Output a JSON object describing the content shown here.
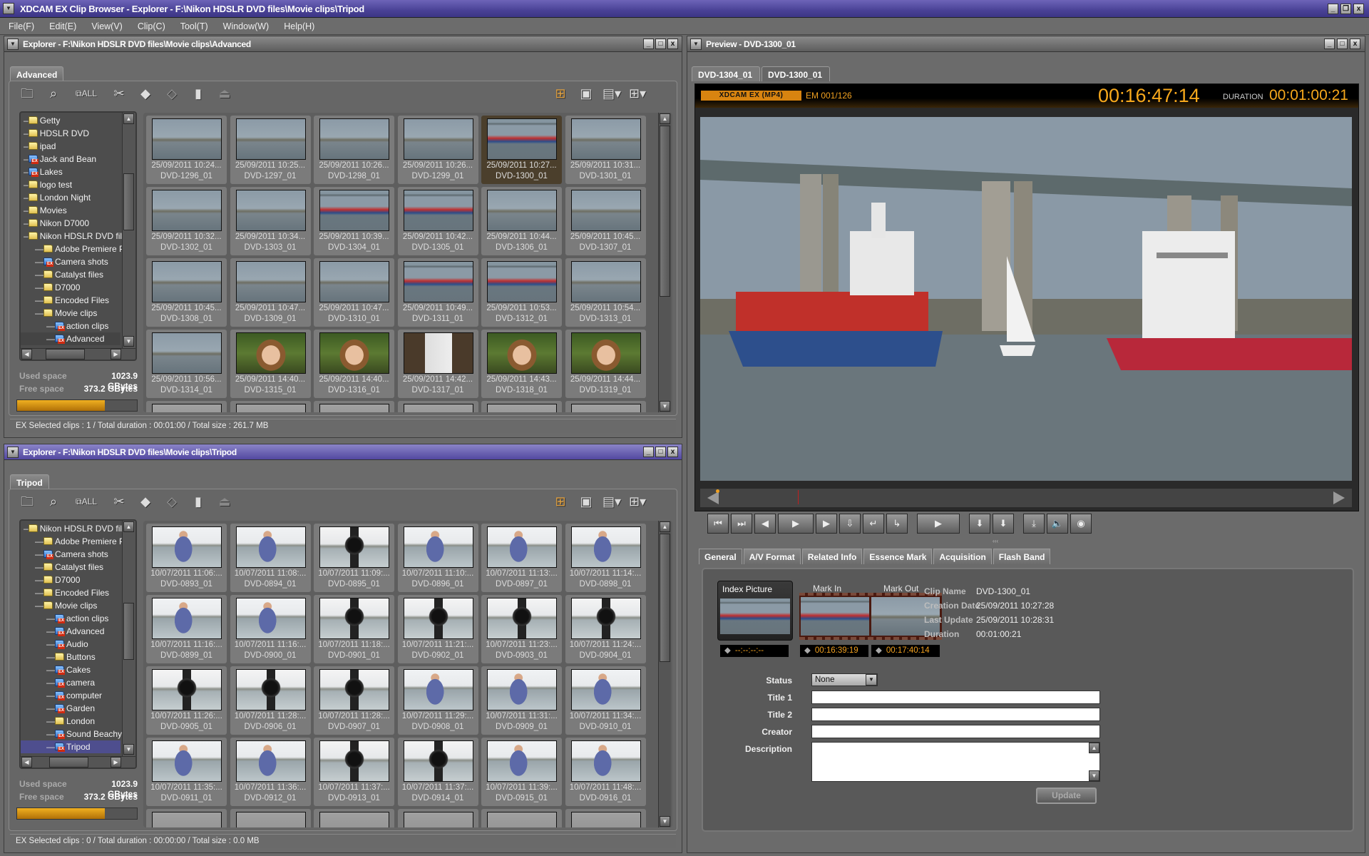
{
  "app": {
    "title": "XDCAM EX Clip Browser - Explorer - F:\\Nikon HDSLR DVD files\\Movie clips\\Tripod"
  },
  "menu": [
    "File(F)",
    "Edit(E)",
    "View(V)",
    "Clip(C)",
    "Tool(T)",
    "Window(W)",
    "Help(H)"
  ],
  "explorers": [
    {
      "title": "Explorer - F:\\Nikon HDSLR DVD files\\Movie clips\\Advanced",
      "tab": "Advanced",
      "tree": [
        {
          "label": "Getty",
          "level": 0,
          "ex": false
        },
        {
          "label": "HDSLR DVD",
          "level": 0,
          "ex": false
        },
        {
          "label": "ipad",
          "level": 0,
          "ex": false
        },
        {
          "label": "Jack and Bean",
          "level": 0,
          "ex": true
        },
        {
          "label": "Lakes",
          "level": 0,
          "ex": true
        },
        {
          "label": "logo test",
          "level": 0,
          "ex": false
        },
        {
          "label": "London Night",
          "level": 0,
          "ex": false
        },
        {
          "label": "Movies",
          "level": 0,
          "ex": false
        },
        {
          "label": "Nikon D7000",
          "level": 0,
          "ex": false
        },
        {
          "label": "Nikon HDSLR DVD files",
          "level": 0,
          "ex": false
        },
        {
          "label": "Adobe Premiere Pro",
          "level": 1,
          "ex": false
        },
        {
          "label": "Camera shots",
          "level": 1,
          "ex": true
        },
        {
          "label": "Catalyst files",
          "level": 1,
          "ex": false
        },
        {
          "label": "D7000",
          "level": 1,
          "ex": false
        },
        {
          "label": "Encoded Files",
          "level": 1,
          "ex": false
        },
        {
          "label": "Movie clips",
          "level": 1,
          "ex": false
        },
        {
          "label": "action clips",
          "level": 2,
          "ex": true
        },
        {
          "label": "Advanced",
          "level": 2,
          "ex": true,
          "selected": true
        }
      ],
      "used_space_label": "Used space",
      "used_space": "1023.9 GBytes",
      "free_space_label": "Free space",
      "free_space": "373.2 GBytes",
      "usage_percent": 73.3,
      "status": "EX   Selected clips : 1 / Total duration : 00:01:00 / Total size : 261.7 MB",
      "clips": [
        {
          "date": "25/09/2011 10:24...",
          "name": "DVD-1296_01"
        },
        {
          "date": "25/09/2011 10:25...",
          "name": "DVD-1297_01"
        },
        {
          "date": "25/09/2011 10:26...",
          "name": "DVD-1298_01"
        },
        {
          "date": "25/09/2011 10:26...",
          "name": "DVD-1299_01"
        },
        {
          "date": "25/09/2011 10:27...",
          "name": "DVD-1300_01",
          "selected": true
        },
        {
          "date": "25/09/2011 10:31...",
          "name": "DVD-1301_01"
        },
        {
          "date": "25/09/2011 10:32...",
          "name": "DVD-1302_01"
        },
        {
          "date": "25/09/2011 10:34...",
          "name": "DVD-1303_01"
        },
        {
          "date": "25/09/2011 10:39...",
          "name": "DVD-1304_01"
        },
        {
          "date": "25/09/2011 10:42...",
          "name": "DVD-1305_01"
        },
        {
          "date": "25/09/2011 10:44...",
          "name": "DVD-1306_01"
        },
        {
          "date": "25/09/2011 10:45...",
          "name": "DVD-1307_01"
        },
        {
          "date": "25/09/2011 10:45...",
          "name": "DVD-1308_01"
        },
        {
          "date": "25/09/2011 10:47...",
          "name": "DVD-1309_01"
        },
        {
          "date": "25/09/2011 10:47...",
          "name": "DVD-1310_01"
        },
        {
          "date": "25/09/2011 10:49...",
          "name": "DVD-1311_01"
        },
        {
          "date": "25/09/2011 10:53...",
          "name": "DVD-1312_01"
        },
        {
          "date": "25/09/2011 10:54...",
          "name": "DVD-1313_01"
        },
        {
          "date": "25/09/2011 10:56...",
          "name": "DVD-1314_01"
        },
        {
          "date": "25/09/2011 14:40...",
          "name": "DVD-1315_01"
        },
        {
          "date": "25/09/2011 14:40...",
          "name": "DVD-1316_01"
        },
        {
          "date": "25/09/2011 14:42...",
          "name": "DVD-1317_01"
        },
        {
          "date": "25/09/2011 14:43...",
          "name": "DVD-1318_01"
        },
        {
          "date": "25/09/2011 14:44...",
          "name": "DVD-1319_01"
        }
      ]
    },
    {
      "title": "Explorer - F:\\Nikon HDSLR DVD files\\Movie clips\\Tripod",
      "tab": "Tripod",
      "tree": [
        {
          "label": "Nikon HDSLR DVD files",
          "level": 0,
          "ex": false
        },
        {
          "label": "Adobe Premiere Pro...",
          "level": 1,
          "ex": false
        },
        {
          "label": "Camera shots",
          "level": 1,
          "ex": true
        },
        {
          "label": "Catalyst files",
          "level": 1,
          "ex": false
        },
        {
          "label": "D7000",
          "level": 1,
          "ex": false
        },
        {
          "label": "Encoded Files",
          "level": 1,
          "ex": false
        },
        {
          "label": "Movie clips",
          "level": 1,
          "ex": false
        },
        {
          "label": "action clips",
          "level": 2,
          "ex": true
        },
        {
          "label": "Advanced",
          "level": 2,
          "ex": true
        },
        {
          "label": "Audio",
          "level": 2,
          "ex": true
        },
        {
          "label": "Buttons",
          "level": 2,
          "ex": false
        },
        {
          "label": "Cakes",
          "level": 2,
          "ex": true
        },
        {
          "label": "camera",
          "level": 2,
          "ex": true
        },
        {
          "label": "computer",
          "level": 2,
          "ex": true
        },
        {
          "label": "Garden",
          "level": 2,
          "ex": true
        },
        {
          "label": "London",
          "level": 2,
          "ex": false
        },
        {
          "label": "Sound Beachy head",
          "level": 2,
          "ex": true
        },
        {
          "label": "Tripod",
          "level": 2,
          "ex": true,
          "selected": true
        }
      ],
      "used_space_label": "Used space",
      "used_space": "1023.9 GBytes",
      "free_space_label": "Free space",
      "free_space": "373.2 GBytes",
      "usage_percent": 73.3,
      "status": "EX   Selected clips : 0 / Total duration : 00:00:00 / Total size : 0.0 MB",
      "clips": [
        {
          "date": "10/07/2011 11:06:...",
          "name": "DVD-0893_01"
        },
        {
          "date": "10/07/2011 11:08:...",
          "name": "DVD-0894_01"
        },
        {
          "date": "10/07/2011 11:09:...",
          "name": "DVD-0895_01"
        },
        {
          "date": "10/07/2011 11:10:...",
          "name": "DVD-0896_01"
        },
        {
          "date": "10/07/2011 11:13:...",
          "name": "DVD-0897_01"
        },
        {
          "date": "10/07/2011 11:14:...",
          "name": "DVD-0898_01"
        },
        {
          "date": "10/07/2011 11:16:...",
          "name": "DVD-0899_01"
        },
        {
          "date": "10/07/2011 11:16:...",
          "name": "DVD-0900_01"
        },
        {
          "date": "10/07/2011 11:18:...",
          "name": "DVD-0901_01"
        },
        {
          "date": "10/07/2011 11:21:...",
          "name": "DVD-0902_01"
        },
        {
          "date": "10/07/2011 11:23:...",
          "name": "DVD-0903_01"
        },
        {
          "date": "10/07/2011 11:24:...",
          "name": "DVD-0904_01"
        },
        {
          "date": "10/07/2011 11:26:...",
          "name": "DVD-0905_01"
        },
        {
          "date": "10/07/2011 11:28:...",
          "name": "DVD-0906_01"
        },
        {
          "date": "10/07/2011 11:28:...",
          "name": "DVD-0907_01"
        },
        {
          "date": "10/07/2011 11:29:...",
          "name": "DVD-0908_01"
        },
        {
          "date": "10/07/2011 11:31:...",
          "name": "DVD-0909_01"
        },
        {
          "date": "10/07/2011 11:34:...",
          "name": "DVD-0910_01"
        },
        {
          "date": "10/07/2011 11:35:...",
          "name": "DVD-0911_01"
        },
        {
          "date": "10/07/2011 11:36:...",
          "name": "DVD-0912_01"
        },
        {
          "date": "10/07/2011 11:37:...",
          "name": "DVD-0913_01"
        },
        {
          "date": "10/07/2011 11:37:...",
          "name": "DVD-0914_01"
        },
        {
          "date": "10/07/2011 11:39:...",
          "name": "DVD-0915_01"
        },
        {
          "date": "10/07/2011 11:48:...",
          "name": "DVD-0916_01"
        }
      ]
    }
  ],
  "preview": {
    "title": "Preview - DVD-1300_01",
    "tabs": [
      "DVD-1304_01",
      "DVD-1300_01"
    ],
    "active_tab": 1,
    "format_badge": "XDCAM EX (MP4)",
    "essence_mark": "EM 001/126",
    "timecode": "00:16:47:14",
    "duration_label": "DURATION",
    "duration": "00:01:00:21",
    "accent": "#f0a020"
  },
  "info": {
    "tabs": [
      "General",
      "A/V Format",
      "Related Info",
      "Essence Mark",
      "Acquisition",
      "Flash Band"
    ],
    "index_picture_label": "Index Picture",
    "index_tc": "--:--:--:--",
    "mark_in_label": "Mark In",
    "mark_out_label": "Mark Out",
    "mark_in_tc": "00:16:39:19",
    "mark_out_tc": "00:17:40:14",
    "clip_fields": [
      {
        "label": "Clip Name",
        "value": "DVD-1300_01"
      },
      {
        "label": "Creation Date",
        "value": "25/09/2011 10:27:28"
      },
      {
        "label": "Last Update",
        "value": "25/09/2011 10:28:31"
      },
      {
        "label": "Duration",
        "value": "00:01:00:21"
      }
    ],
    "status_label": "Status",
    "status_value": "None",
    "title1_label": "Title 1",
    "title1_value": "",
    "title2_label": "Title 2",
    "title2_value": "",
    "creator_label": "Creator",
    "creator_value": "",
    "description_label": "Description",
    "description_value": "",
    "update_button": "Update"
  }
}
